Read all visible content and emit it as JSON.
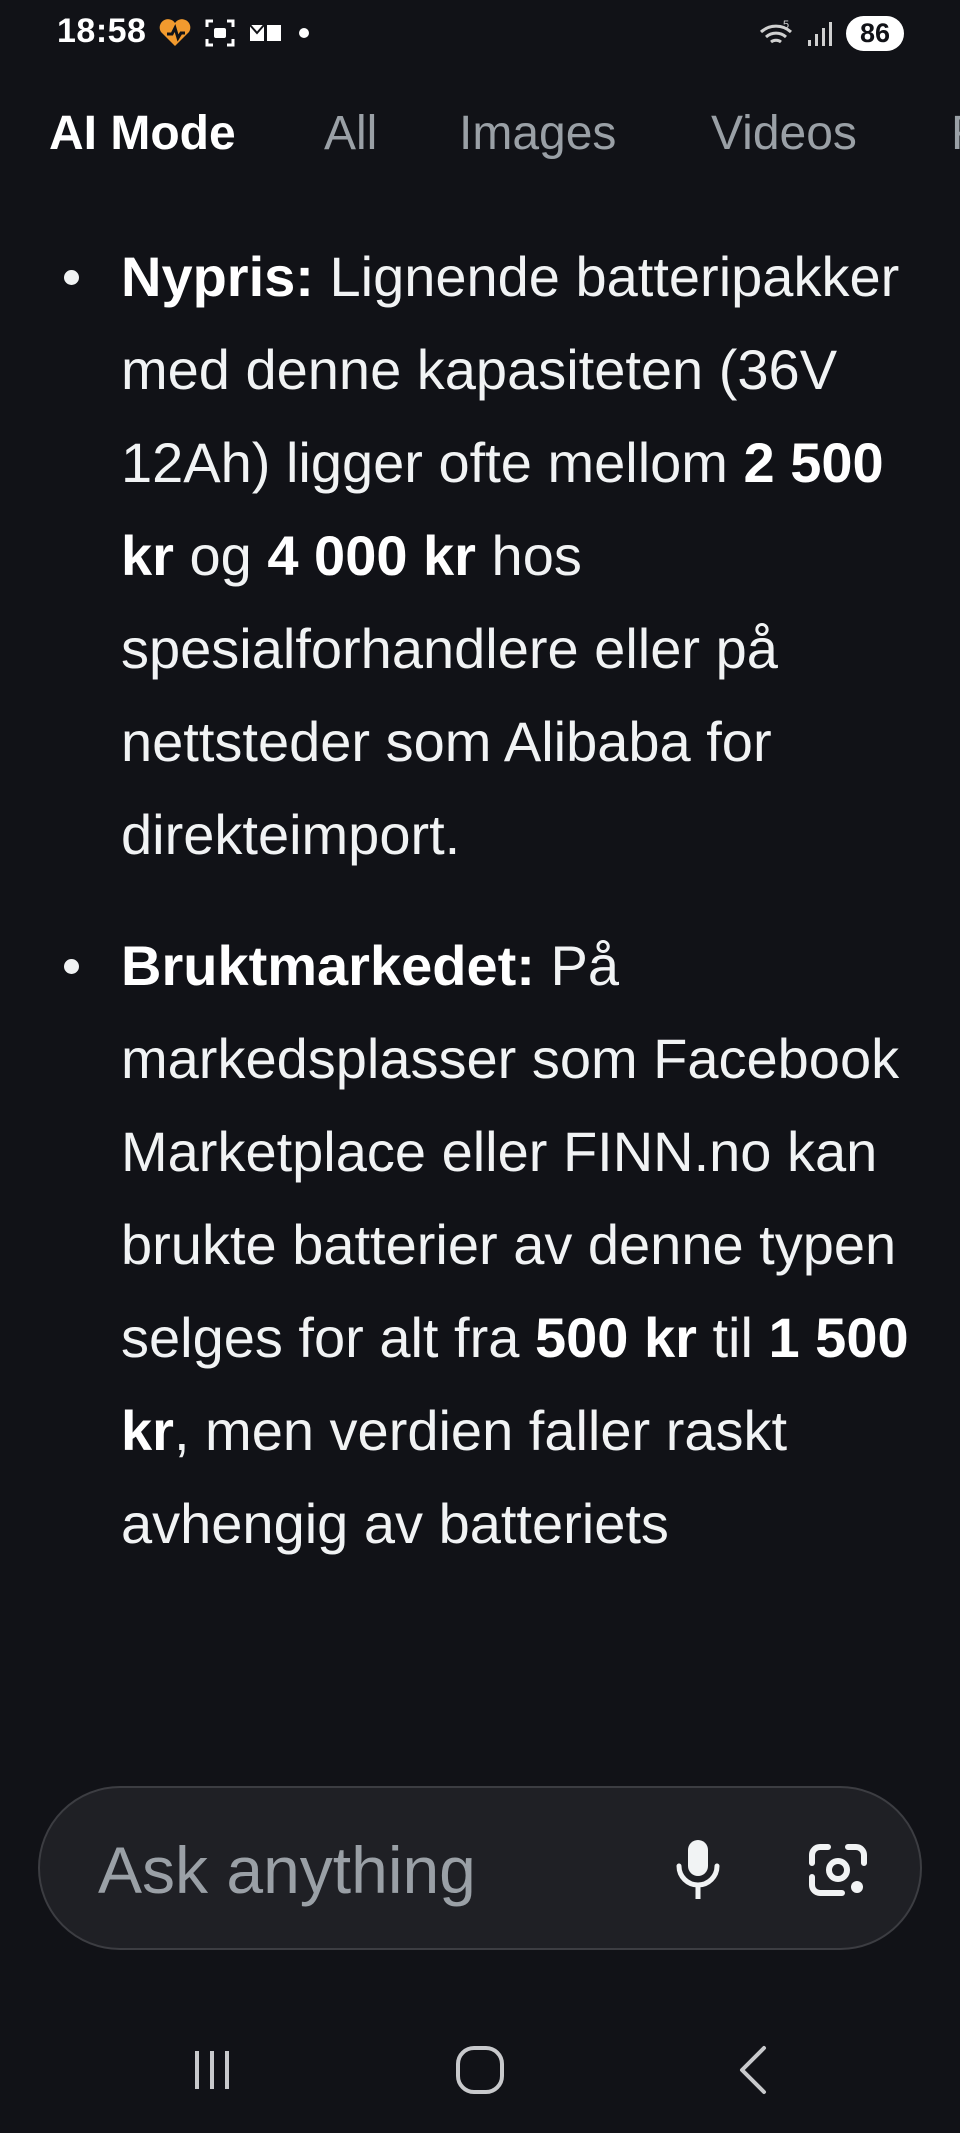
{
  "status_bar": {
    "time": "18:58",
    "battery": "86",
    "wifi_label": "5"
  },
  "tabs": [
    {
      "label": "AI Mode",
      "active": true
    },
    {
      "label": "All"
    },
    {
      "label": "Images"
    },
    {
      "label": "Videos"
    },
    {
      "label": "F"
    }
  ],
  "content": {
    "bullet1": {
      "term": "Nypris:",
      "t1": " Lignende batteripakker med denne kapasiteten (36V 12Ah) ligger ofte mellom ",
      "b1": "2 500 kr",
      "t2": " og ",
      "b2": "4 000 kr",
      "t3": " hos spesialforhandlere eller på nettsteder som Alibaba for direkteimport."
    },
    "bullet2": {
      "term": "Bruktmarkedet:",
      "t1": " På markedsplasser som Facebook Marketplace eller FINN.no kan brukte batterier av denne typen selges for alt fra ",
      "b1": "500 kr",
      "t2": " til ",
      "b2": "1 500 kr",
      "t3": ", men verdien faller raskt avhengig av batteriets"
    }
  },
  "ask_bar": {
    "placeholder": "Ask anything"
  },
  "icons": {
    "mic": "mic-icon",
    "lens": "google-lens-icon",
    "recents": "recents-icon",
    "home": "home-icon",
    "back": "back-icon"
  },
  "colors": {
    "background": "#111217",
    "text": "#f1f3f4",
    "muted": "#9aa0a6",
    "ask_bar_bg": "#1f2025"
  }
}
